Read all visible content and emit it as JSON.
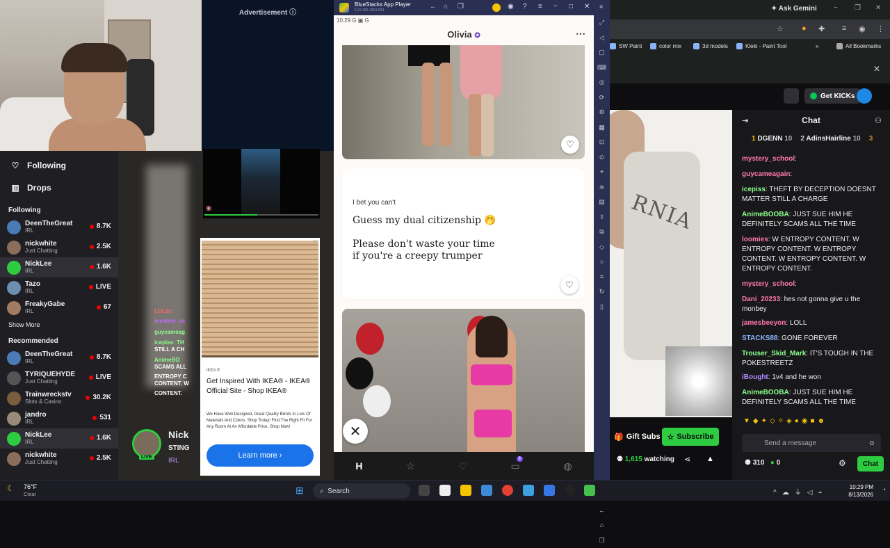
{
  "ad_panel": {
    "label": "Advertisement ⓘ"
  },
  "sidebar": {
    "nav": [
      {
        "label": "Following",
        "icon": "heart-icon"
      },
      {
        "label": "Drops",
        "icon": "drops-icon"
      }
    ],
    "following_title": "Following",
    "following": [
      {
        "name": "DeenTheGreat",
        "category": "IRL",
        "viewers": "8.7K"
      },
      {
        "name": "nickwhite",
        "category": "Just Chatting",
        "viewers": "2.5K"
      },
      {
        "name": "NickLee",
        "category": "IRL",
        "viewers": "1.6K"
      },
      {
        "name": "Tazo",
        "category": "IRL",
        "viewers": "LIVE"
      },
      {
        "name": "FreakyGabe",
        "category": "IRL",
        "viewers": "67"
      }
    ],
    "show_more": "Show More",
    "recommended_title": "Recommended",
    "recommended": [
      {
        "name": "DeenTheGreat",
        "category": "IRL",
        "viewers": "8.7K"
      },
      {
        "name": "TYRIQUEHYDE",
        "category": "Just Chatting",
        "viewers": "LIVE"
      },
      {
        "name": "Trainwreckstv",
        "category": "Slots & Casino",
        "viewers": "30.2K"
      },
      {
        "name": "jandro",
        "category": "IRL",
        "viewers": "531"
      },
      {
        "name": "NickLee",
        "category": "IRL",
        "viewers": "1.6K"
      },
      {
        "name": "nickwhite",
        "category": "Just Chatting",
        "viewers": "2.5K"
      }
    ]
  },
  "mid_stream": {
    "chat_lines": [
      "LOLiri:",
      "mystery_sc",
      "guycameag",
      "icepiss: TH",
      "STILL A CH",
      "AnimeBO",
      "SCAMS ALL",
      "ENTROPY C",
      "CONTENT. W",
      "CONTENT."
    ],
    "streamer_name": "Nick",
    "stream_title": "STING",
    "category": "IRL",
    "live_badge": "LIVE"
  },
  "ikea_ad": {
    "brand": "IKEA ®",
    "headline": "Get Inspired With IKEA® - IKEA® Official Site - Shop IKEA®",
    "description": "We Have Well-Designed, Great Quality Blinds In Lots Of Materials And Colors. Shop Today! Find The Right Fit For Any Room At An Affordable Price. Shop Now!",
    "cta": "Learn more ›"
  },
  "bluestacks": {
    "title": "BlueStacks App Player",
    "version": "5.22.160.1053 P64",
    "status_time": "10:29",
    "status_icons": "G ▣ G"
  },
  "hinge": {
    "profile_name": "Olivia",
    "prompt_question": "I bet you can't",
    "prompt_answer": "Guess my dual citizenship 🤭\n\nPlease don't waste your time\nif you're a creepy trumper",
    "tab_badge": "3"
  },
  "browser": {
    "gemini": "Ask Gemini",
    "bookmarks": [
      "SW Paint",
      "color mix",
      "3d models",
      "Kleki - Paint Tool"
    ],
    "all_bookmarks": "All Bookmarks"
  },
  "twitch": {
    "get_kicks": "Get KICKs",
    "chat_title": "Chat",
    "leaderboard": [
      {
        "rank": "1",
        "name": "DGENN",
        "score": "10"
      },
      {
        "rank": "2",
        "name": "AdinsHairline",
        "score": "10"
      },
      {
        "rank": "3",
        "name": "",
        "score": ""
      }
    ],
    "messages": [
      {
        "user": "mystery_school",
        "text": ":",
        "color": "#ff7aa8"
      },
      {
        "user": "guycameagain",
        "text": ":",
        "color": "#ff7aa8"
      },
      {
        "user": "icepiss",
        "text": ": THEFT BY DECEPTION DOESNT MATTER STILL A CHARGE",
        "color": "#8cff8c"
      },
      {
        "user": "AnimeBOOBA",
        "text": ": JUST SUE HIM HE DEFINITELY SCAMS ALL THE TIME",
        "color": "#8cff8c"
      },
      {
        "user": "loomies",
        "text": ": W ENTROPY CONTENT. W ENTROPY CONTENT. W ENTROPY CONTENT. W ENTROPY CONTENT. W ENTROPY CONTENT.",
        "color": "#ff7aa8"
      },
      {
        "user": "mystery_school",
        "text": ":",
        "color": "#ff7aa8"
      },
      {
        "user": "Dani_20233",
        "text": ": hes not gonna give u the monbey",
        "color": "#ff7aa8"
      },
      {
        "user": "jamesbeeyon",
        "text": ": LOLL",
        "color": "#ff7aa8"
      },
      {
        "user": "STACKS88",
        "text": ": GONE FOREVER",
        "color": "#8ab4f8"
      },
      {
        "user": "Trouser_Skid_Mark",
        "text": ": IT'S TOUGH IN THE POKESTREETZ",
        "color": "#8cff8c"
      },
      {
        "user": "iBought",
        "text": ": 1v4 and he won",
        "color": "#b58cff"
      },
      {
        "user": "AnimeBOOBA",
        "text": ": JUST SUE HIM HE DEFINITELY SCAMS ALL THE TIME",
        "color": "#8cff8c"
      }
    ],
    "gift_subs": "Gift Subs",
    "subscribe": "Subscribe",
    "watching_count": "1,615",
    "watching_label": "watching",
    "input_placeholder": "Send a message",
    "points": "310",
    "kicks": "0",
    "chat_button": "Chat"
  },
  "taskbar": {
    "temp": "76°F",
    "condition": "Clear",
    "search": "Search",
    "time": "10:29 PM",
    "date": "8/13/2026"
  }
}
